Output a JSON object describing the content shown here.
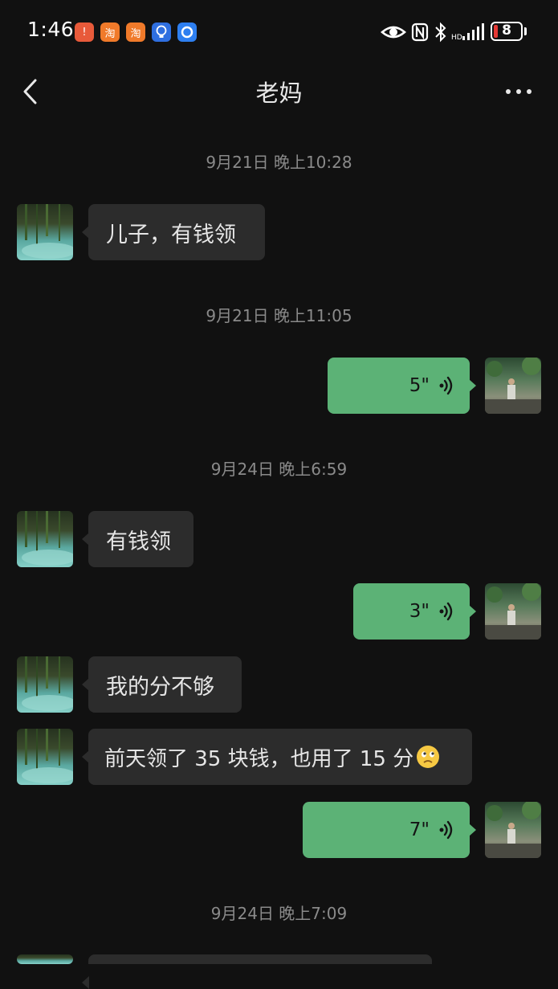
{
  "status_bar": {
    "time": "1:46",
    "battery_level": "8",
    "app_icons": [
      {
        "name": "notification-app-icon",
        "color": "#e85a3a",
        "glyph": "!"
      },
      {
        "name": "taobao-app-icon",
        "color": "#f07a2a",
        "glyph": "淘"
      },
      {
        "name": "taobao-app-icon-2",
        "color": "#f07a2a",
        "glyph": "淘"
      },
      {
        "name": "bulb-app-icon",
        "color": "#2f6fe0",
        "glyph": "💡"
      },
      {
        "name": "browser-app-icon",
        "color": "#2e7ff0",
        "glyph": "◉"
      }
    ]
  },
  "header": {
    "title": "老妈",
    "back_icon": "chevron-left-icon",
    "more_icon": "more-dots-icon"
  },
  "messages": [
    {
      "type": "time",
      "text": "9月21日 晚上10:28"
    },
    {
      "type": "text",
      "from": "mom",
      "text": "儿子，有钱领"
    },
    {
      "type": "time",
      "text": "9月21日 晚上11:05"
    },
    {
      "type": "voice",
      "from": "me",
      "duration": "5\""
    },
    {
      "type": "time",
      "text": "9月24日 晚上6:59"
    },
    {
      "type": "text",
      "from": "mom",
      "text": "有钱领"
    },
    {
      "type": "voice",
      "from": "me",
      "duration": "3\""
    },
    {
      "type": "text",
      "from": "mom",
      "text": "我的分不够"
    },
    {
      "type": "text",
      "from": "mom",
      "text": "前天领了 35 块钱，也用了 15 分",
      "emoji": "thinking-face-emoji"
    },
    {
      "type": "voice",
      "from": "me",
      "duration": "7\""
    },
    {
      "type": "time",
      "text": "9月24日 晚上7:09"
    }
  ],
  "colors": {
    "background": "#111111",
    "incoming_bubble": "#2c2c2c",
    "outgoing_bubble": "#5cb276",
    "timestamp": "#8a8a8a"
  }
}
